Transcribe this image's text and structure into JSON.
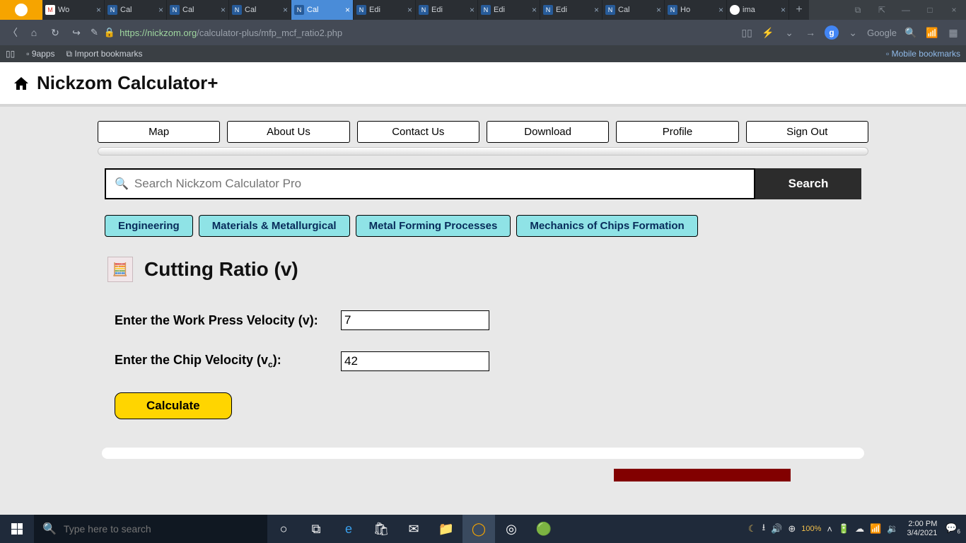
{
  "browser": {
    "tabs": [
      {
        "label": "Wo",
        "fav": "M"
      },
      {
        "label": "Cal",
        "fav": "N"
      },
      {
        "label": "Cal",
        "fav": "N"
      },
      {
        "label": "Cal",
        "fav": "N"
      },
      {
        "label": "Cal",
        "fav": "N",
        "active": true
      },
      {
        "label": "Edi",
        "fav": "N"
      },
      {
        "label": "Edi",
        "fav": "N"
      },
      {
        "label": "Edi",
        "fav": "N"
      },
      {
        "label": "Edi",
        "fav": "N"
      },
      {
        "label": "Cal",
        "fav": "N"
      },
      {
        "label": "Ho",
        "fav": "N"
      },
      {
        "label": "ima",
        "fav": "G"
      }
    ],
    "url_scheme": "https://",
    "url_host": "nickzom.org",
    "url_path": "/calculator-plus/mfp_mcf_ratio2.php",
    "search_engine": "Google",
    "bookmarks": {
      "a": "9apps",
      "b": "Import bookmarks",
      "c": "Mobile bookmarks"
    }
  },
  "page": {
    "title": "Nickzom Calculator+",
    "nav": [
      "Map",
      "About Us",
      "Contact Us",
      "Download",
      "Profile",
      "Sign Out"
    ],
    "search_placeholder": "Search Nickzom Calculator Pro",
    "search_button": "Search",
    "crumbs": [
      "Engineering",
      "Materials & Metallurgical",
      "Metal Forming Processes",
      "Mechanics of Chips Formation"
    ],
    "calculator_title": "Cutting Ratio (v)",
    "fields": {
      "work_press_velocity": {
        "label": "Enter the Work Press Velocity (v):",
        "value": "7"
      },
      "chip_velocity": {
        "label_pre": "Enter the Chip Velocity (v",
        "label_sub": "c",
        "label_post": "):",
        "value": "42"
      }
    },
    "calc_button": "Calculate"
  },
  "taskbar": {
    "search_placeholder": "Type here to search",
    "battery_pct": "100%",
    "time": "2:00 PM",
    "date": "3/4/2021",
    "notif_count": "6"
  }
}
